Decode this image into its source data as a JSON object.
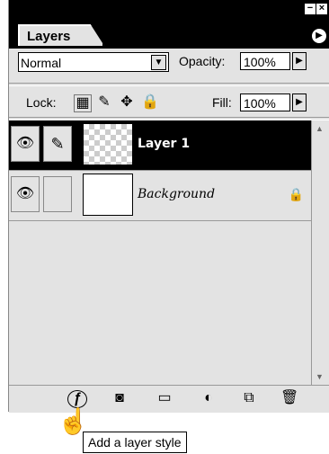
{
  "panel": {
    "tab_label": "Layers",
    "min_glyph": "−",
    "close_glyph": "×",
    "menu_glyph": "▶"
  },
  "blending": {
    "mode": "Normal",
    "opacity_label": "Opacity:",
    "opacity_value": "100%",
    "lock_label": "Lock:",
    "fill_label": "Fill:",
    "fill_value": "100%"
  },
  "layers": [
    {
      "name": "Layer 1",
      "selected": true,
      "visible": true
    },
    {
      "name": "Background",
      "selected": false,
      "visible": true,
      "locked": true
    }
  ],
  "icons": {
    "eye": "👁",
    "brush": "✎",
    "lock": "🔒",
    "dropdown": "▼",
    "stepper": "▶",
    "scroll_up": "▲",
    "scroll_down": "▼",
    "move": "✥",
    "trash": "🗑",
    "folder": "▭",
    "mask": "◙",
    "adjust": "◐",
    "new_layer": "⧉",
    "fx": "ƒ",
    "hand": "☝",
    "lock_transparent": "▦",
    "lock_image": "✎"
  },
  "tooltip": "Add a layer style"
}
